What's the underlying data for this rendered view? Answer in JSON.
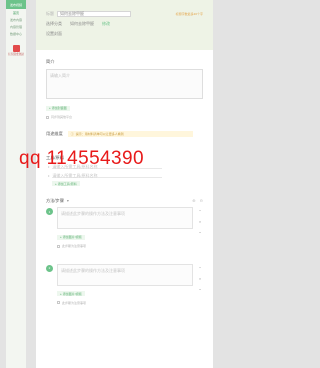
{
  "rail": {
    "logo": "发布视频",
    "items": [
      "首页",
      "发布内容",
      "内容管理",
      "数据中心"
    ],
    "feature_label": "红包现金激励"
  },
  "header": {
    "title_hint": "标题",
    "title_value": "如何去除甲醛",
    "warning": "标题字数最多30个字",
    "category_label": "选择分类",
    "category_value": "如何去除甲醛",
    "category_tag": "修改",
    "cover_label": "设置封面"
  },
  "intro": {
    "label": "简介",
    "placeholder": "请输入简介",
    "add_button": "添加封面图",
    "checkbox_label": "同步到其他平台"
  },
  "materials": {
    "label": "用途维度",
    "notice": "提示：用材料清单可以让更多人看到",
    "tools_label": "工具/原料",
    "tool_placeholders": [
      "请输入所需工具/原料名称",
      "请输入所需工具/原料名称"
    ],
    "add_button": "添加工具/原料"
  },
  "steps": {
    "label": "方法/步骤",
    "toggle": "▾",
    "actions": [
      "⊕",
      "⊖"
    ],
    "items": [
      {
        "num": "1",
        "placeholder": "请描述此步骤的操作方法及注意事项",
        "add_image": "添加图片/视频",
        "check": "此步骤为注意事项"
      },
      {
        "num": "2",
        "placeholder": "请描述此步骤的操作方法及注意事项",
        "add_image": "添加图片/视频",
        "check": "此步骤为注意事项"
      }
    ]
  },
  "watermark": "qq  114554390",
  "colors": {
    "accent": "#6cc38a",
    "header_bg": "#eef3e6",
    "warning": "#e4a54a",
    "watermark": "#e81a1a"
  }
}
